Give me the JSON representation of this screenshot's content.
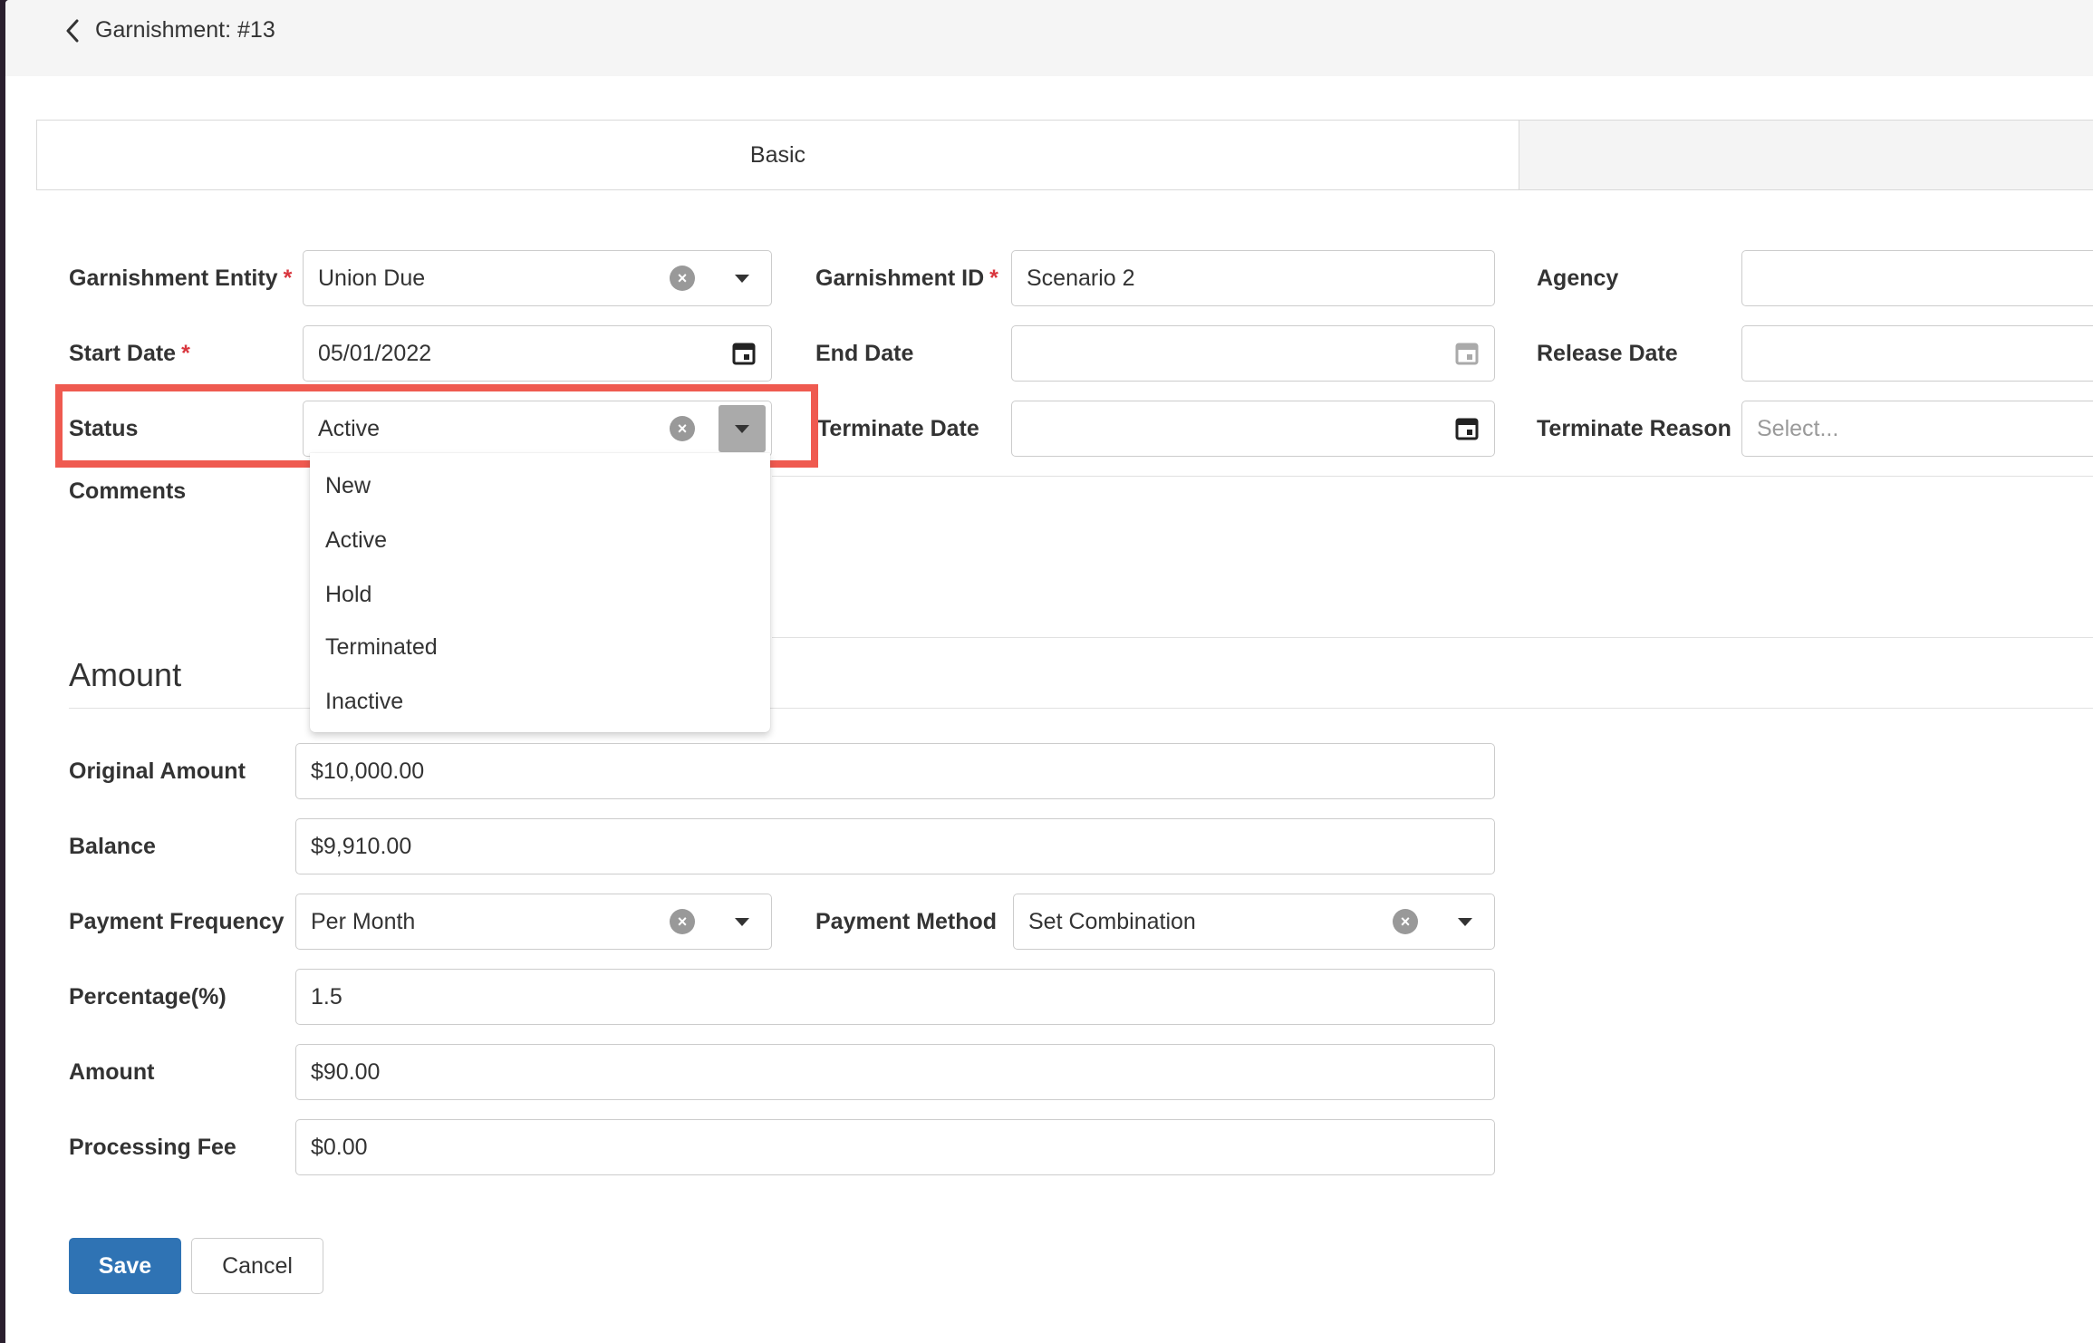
{
  "header": {
    "title": "Garnishment: #13"
  },
  "tabs": [
    {
      "label": "Basic"
    },
    {
      "label": ""
    }
  ],
  "basic": {
    "garnishment_entity": {
      "label": "Garnishment Entity",
      "value": "Union Due"
    },
    "garnishment_id": {
      "label": "Garnishment ID",
      "value": "Scenario 2"
    },
    "agency": {
      "label": "Agency",
      "value": ""
    },
    "start_date": {
      "label": "Start Date",
      "value": "05/01/2022"
    },
    "end_date": {
      "label": "End Date",
      "value": ""
    },
    "release_date": {
      "label": "Release Date",
      "value": ""
    },
    "status": {
      "label": "Status",
      "value": "Active"
    },
    "terminate_date": {
      "label": "Terminate Date",
      "value": ""
    },
    "terminate_reason": {
      "label": "Terminate Reason",
      "placeholder": "Select..."
    },
    "comments": {
      "label": "Comments"
    },
    "required_mark": "*"
  },
  "status_options": [
    "New",
    "Active",
    "Hold",
    "Terminated",
    "Inactive"
  ],
  "amount_section": {
    "title": "Amount",
    "original_amount": {
      "label": "Original Amount",
      "value": "$10,000.00"
    },
    "balance": {
      "label": "Balance",
      "value": "$9,910.00"
    },
    "payment_frequency": {
      "label": "Payment Frequency",
      "value": "Per Month"
    },
    "payment_method": {
      "label": "Payment Method",
      "value": "Set Combination"
    },
    "percentage": {
      "label": "Percentage(%)",
      "value": "1.5"
    },
    "amount": {
      "label": "Amount",
      "value": "$90.00"
    },
    "processing_fee": {
      "label": "Processing Fee",
      "value": "$0.00"
    }
  },
  "actions": {
    "save": "Save",
    "cancel": "Cancel"
  }
}
